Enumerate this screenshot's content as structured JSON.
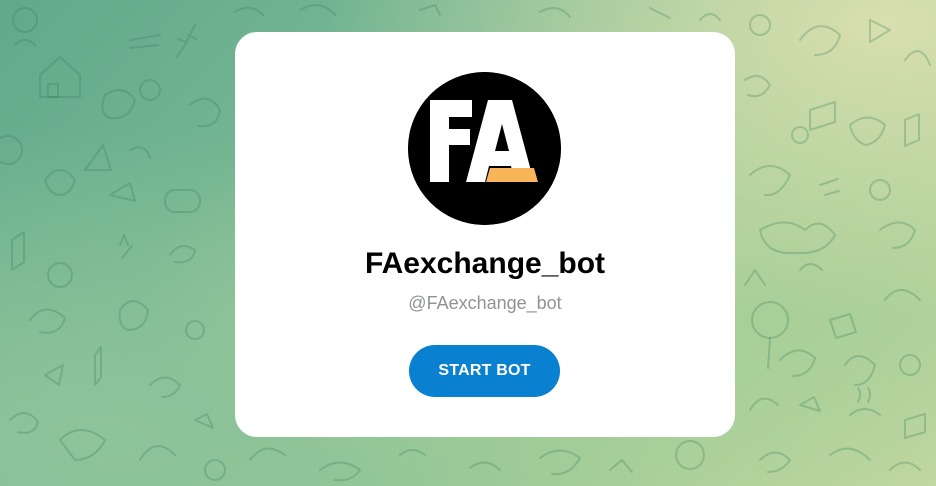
{
  "bot": {
    "name": "FAexchange_bot",
    "username": "@FAexchange_bot",
    "avatar_text": "FA"
  },
  "actions": {
    "start_label": "START BOT"
  },
  "colors": {
    "accent": "#0a80d1",
    "avatar_background": "#000000",
    "avatar_stripe": "#f7b458",
    "card_background": "#ffffff",
    "username_text": "#8e9396"
  },
  "icons": {
    "background_pattern": "telegram-doodle-pattern"
  }
}
